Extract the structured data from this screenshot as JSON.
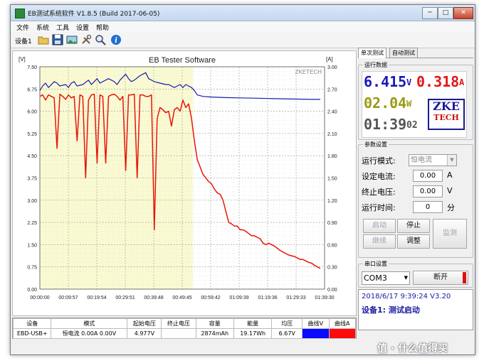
{
  "window": {
    "title": "EB测试系统软件 V1.8.5 (Build 2017-06-05)",
    "controls": {
      "minimize": "─",
      "maximize": "□",
      "close": "✕"
    }
  },
  "menu": [
    "文件",
    "系统",
    "工具",
    "设置",
    "帮助"
  ],
  "toolbar": {
    "device_label": "设备1",
    "icons": [
      "open-folder-icon",
      "save-icon",
      "image-icon",
      "tools-icon",
      "search-icon",
      "info-icon"
    ]
  },
  "chart_data": {
    "type": "line",
    "title": "EB Tester Software",
    "watermark": "ZKETECH",
    "left_axis_unit": "[V]",
    "right_axis_unit": "[A]",
    "y_left_ticks": [
      "7.50",
      "6.75",
      "6.00",
      "5.25",
      "4.50",
      "3.75",
      "3.00",
      "2.25",
      "1.50",
      "0.75",
      "0.00"
    ],
    "y_right_ticks": [
      "3.00",
      "2.70",
      "2.40",
      "2.10",
      "1.80",
      "1.50",
      "1.20",
      "0.90",
      "0.60",
      "0.30",
      "0.00"
    ],
    "x_ticks": [
      "00:00:00",
      "00:09:57",
      "00:19:54",
      "00:29:51",
      "00:39:48",
      "00:49:45",
      "00:59:42",
      "01:09:39",
      "01:19:36",
      "01:29:33",
      "01:39:30"
    ],
    "ylim_left": [
      0,
      7.5
    ],
    "ylim_right": [
      0,
      3.0
    ],
    "xlim_minutes": [
      0,
      99.5
    ],
    "highlight_region_minutes": [
      0,
      53.5
    ],
    "series": [
      {
        "name": "曲线V",
        "axis": "left",
        "color": "#1a1ab0",
        "x": [
          0,
          1,
          2,
          3,
          5,
          6,
          7,
          9,
          10,
          11,
          12,
          13,
          15,
          17,
          18,
          19,
          20,
          21,
          22,
          24,
          26,
          27,
          28,
          29,
          30,
          31,
          32,
          33,
          35,
          37,
          38,
          40,
          42,
          44,
          45,
          47,
          48,
          49,
          50,
          51,
          52,
          53,
          54,
          55,
          57,
          60,
          65,
          70,
          75,
          80,
          85,
          90,
          95,
          98
        ],
        "y": [
          6.7,
          6.85,
          6.95,
          6.8,
          7.0,
          6.95,
          6.85,
          6.9,
          6.8,
          6.95,
          7.0,
          6.85,
          6.9,
          7.05,
          6.9,
          7.0,
          7.1,
          6.95,
          7.0,
          7.1,
          7.0,
          6.9,
          7.05,
          7.15,
          7.25,
          7.1,
          7.0,
          7.05,
          7.2,
          7.3,
          7.1,
          7.0,
          6.95,
          6.9,
          6.9,
          6.8,
          6.85,
          6.9,
          6.8,
          6.9,
          6.85,
          6.8,
          6.7,
          6.55,
          6.5,
          6.48,
          6.46,
          6.45,
          6.44,
          6.43,
          6.42,
          6.41,
          6.4,
          6.4
        ]
      },
      {
        "name": "曲线A",
        "axis": "right",
        "color": "#e8160c",
        "x": [
          0,
          1,
          2,
          3,
          4,
          5,
          6,
          7,
          8,
          9,
          10,
          11,
          12,
          13,
          14,
          15,
          16,
          17,
          18,
          19,
          20,
          21,
          22,
          23,
          24,
          25,
          26,
          27,
          28,
          29,
          30,
          31,
          32,
          33,
          34,
          35,
          36,
          37,
          38,
          39,
          40,
          41,
          42,
          43,
          44,
          45,
          46,
          47,
          48,
          49,
          50,
          51,
          52,
          53,
          54,
          55,
          56,
          57,
          58,
          59,
          60,
          61,
          62,
          63,
          64,
          65,
          66,
          67,
          68,
          69,
          70,
          71,
          72,
          73,
          74,
          75,
          76,
          77,
          78,
          79,
          80,
          81,
          82,
          83,
          84,
          85,
          86,
          87,
          88,
          89,
          90,
          91,
          92,
          93,
          94,
          95,
          96,
          97,
          98
        ],
        "y": [
          2.6,
          2.62,
          2.55,
          2.62,
          2.6,
          2.58,
          1.9,
          2.63,
          2.6,
          2.56,
          2.62,
          2.58,
          2.6,
          2.0,
          2.62,
          2.6,
          1.5,
          2.55,
          2.62,
          2.63,
          1.7,
          2.62,
          2.6,
          1.7,
          2.6,
          2.62,
          2.63,
          2.6,
          2.55,
          2.6,
          1.6,
          2.62,
          2.62,
          2.63,
          1.5,
          2.62,
          2.62,
          2.6,
          2.6,
          2.62,
          0.8,
          2.3,
          2.45,
          2.42,
          2.38,
          2.4,
          2.2,
          2.42,
          2.45,
          2.4,
          2.55,
          2.45,
          2.5,
          2.3,
          2.0,
          1.75,
          1.65,
          1.55,
          1.5,
          1.45,
          1.42,
          1.35,
          1.3,
          1.28,
          1.2,
          1.05,
          0.9,
          0.88,
          0.85,
          0.85,
          0.8,
          0.8,
          0.78,
          0.75,
          0.72,
          0.72,
          0.7,
          0.68,
          0.62,
          0.6,
          0.62,
          0.6,
          0.58,
          0.55,
          0.52,
          0.5,
          0.48,
          0.46,
          0.45,
          0.44,
          0.42,
          0.4,
          0.4,
          0.38,
          0.36,
          0.35,
          0.32,
          0.3,
          0.28
        ]
      }
    ]
  },
  "summary_table": {
    "headers": [
      "设备",
      "模式",
      "起始电压",
      "终止电压",
      "容量",
      "能量",
      "均压",
      "曲线V",
      "曲线A"
    ],
    "row": [
      "EBD-USB+",
      "恒电流 0.00A 0.00V",
      "4.977V",
      "",
      "2874mAh",
      "19.17Wh",
      "6.67V",
      "",
      ""
    ],
    "curve_v_color": "#0a0aff",
    "curve_a_color": "#ff0a0a"
  },
  "right_panel": {
    "tabs": [
      "单次测试",
      "自动测试"
    ],
    "running_data_title": "运行数据",
    "voltage": "6.415",
    "voltage_unit": "V",
    "current": "0.318",
    "current_unit": "A",
    "power": "02.04",
    "power_unit": "W",
    "time": "01:39",
    "time_sec": "02",
    "logo_line1": "ZKE",
    "logo_line2": "TECH",
    "params_title": "参数设置",
    "mode_label": "运行模式:",
    "mode_value": "恒电流",
    "set_current_label": "设定电流:",
    "set_current_value": "0.00",
    "set_current_unit": "A",
    "stop_voltage_label": "终止电压:",
    "stop_voltage_value": "0.00",
    "stop_voltage_unit": "V",
    "run_time_label": "运行时间:",
    "run_time_value": "0",
    "run_time_unit": "分",
    "btn_start": "启动",
    "btn_stop": "停止",
    "btn_continue": "继续",
    "btn_adjust": "调整",
    "btn_monitor": "监测",
    "serial_title": "串口设置",
    "com_port": "COM3",
    "btn_disconnect": "断开",
    "status_line1": "2018/6/17 9:39:24  V3.20",
    "status_line2": "设备1: 测试启动"
  },
  "watermark_text": "值 · 什么值得买"
}
